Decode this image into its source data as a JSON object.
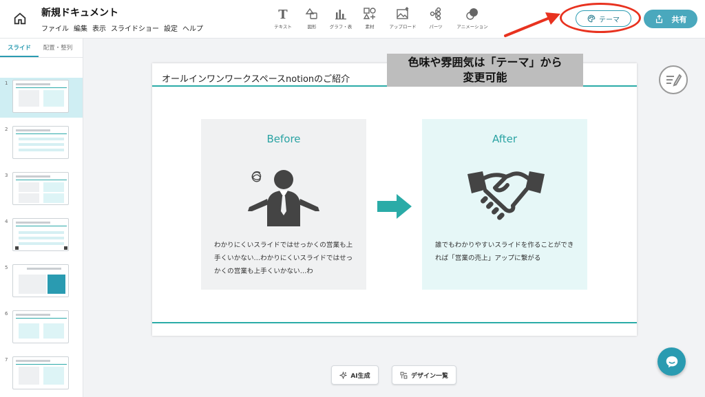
{
  "header": {
    "doc_title": "新規ドキュメント",
    "menu": [
      "ファイル",
      "編集",
      "表示",
      "スライドショー",
      "設定",
      "ヘルプ"
    ],
    "toolbar": [
      {
        "label": "テキスト",
        "icon": "text-icon"
      },
      {
        "label": "図形",
        "icon": "shape-icon"
      },
      {
        "label": "グラフ・表",
        "icon": "chart-icon"
      },
      {
        "label": "素材",
        "icon": "material-icon"
      },
      {
        "label": "アップロード",
        "icon": "upload-icon"
      },
      {
        "label": "パーツ",
        "icon": "parts-icon"
      },
      {
        "label": "アニメーション",
        "icon": "animation-icon"
      }
    ],
    "theme_label": "テーマ",
    "share_label": "共有"
  },
  "sidebar": {
    "tabs": [
      "スライド",
      "配置・整列"
    ],
    "thumbnails": [
      "1",
      "2",
      "3",
      "4",
      "5",
      "6",
      "7"
    ]
  },
  "slide": {
    "title": "オールインワンワークスペースnotionのご紹介",
    "before": {
      "heading": "Before",
      "body": "わかりにくいスライドではせっかくの営業も上手くいかない…わかりにくいスライドではせっかくの営業も上手くいかない…わ"
    },
    "after": {
      "heading": "After",
      "body": "誰でもわかりやすいスライドを作ることができれば「営業の売上」アップに繋がる"
    }
  },
  "annotation": {
    "line1": "色味や雰囲気は「テーマ」から",
    "line2": "変更可能"
  },
  "bottom": {
    "ai_label": "AI生成",
    "design_label": "デザイン一覧"
  },
  "colors": {
    "accent": "#2a9bb1",
    "teal_rule": "#2aaba7",
    "annotation_red": "#e8321f",
    "after_panel": "#e6f7f7",
    "before_panel": "#f0f1f2"
  }
}
